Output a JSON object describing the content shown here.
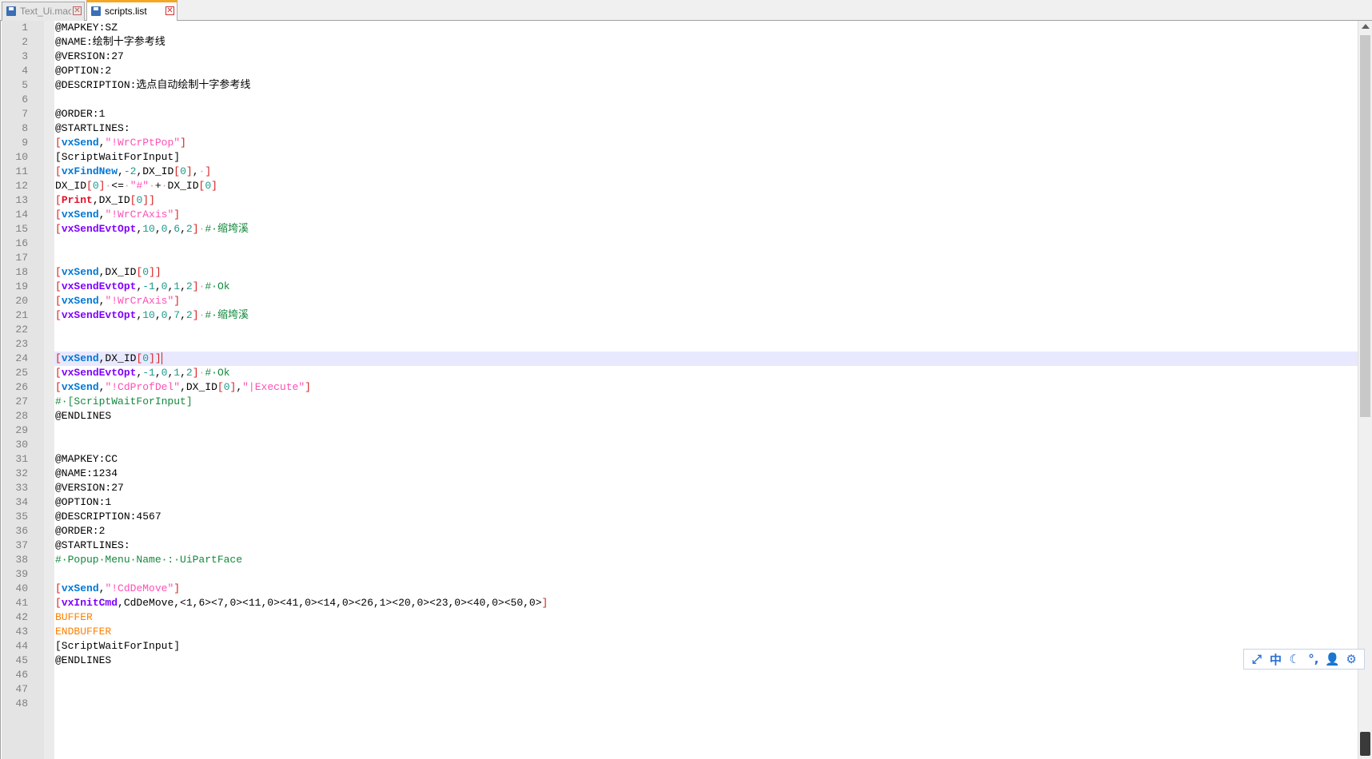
{
  "tabs": [
    {
      "label": "Text_Ui.mac",
      "active": false,
      "close_glyph": "✕"
    },
    {
      "label": "scripts.list",
      "active": true,
      "close_glyph": "✕"
    }
  ],
  "editor": {
    "current_line": 24,
    "lines": [
      {
        "n": "1",
        "t": [
          [
            "p",
            "@MAPKEY:SZ"
          ]
        ]
      },
      {
        "n": "2",
        "t": [
          [
            "p",
            "@NAME:绘制十字参考线"
          ]
        ]
      },
      {
        "n": "3",
        "t": [
          [
            "p",
            "@VERSION:27"
          ]
        ]
      },
      {
        "n": "4",
        "t": [
          [
            "p",
            "@OPTION:2"
          ]
        ]
      },
      {
        "n": "5",
        "t": [
          [
            "p",
            "@DESCRIPTION:选点自动绘制十字参考线"
          ]
        ]
      },
      {
        "n": "6",
        "t": []
      },
      {
        "n": "7",
        "t": [
          [
            "p",
            "@ORDER:1"
          ]
        ]
      },
      {
        "n": "8",
        "t": [
          [
            "p",
            "@STARTLINES:"
          ]
        ]
      },
      {
        "n": "9",
        "t": [
          [
            "br",
            "["
          ],
          [
            "kw",
            "vxSend"
          ],
          [
            "p",
            ","
          ],
          [
            "str",
            "\"!WrCrPtPop\""
          ],
          [
            "br",
            "]"
          ]
        ]
      },
      {
        "n": "10",
        "t": [
          [
            "p",
            "[ScriptWaitForInput]"
          ]
        ]
      },
      {
        "n": "11",
        "t": [
          [
            "br",
            "["
          ],
          [
            "kw",
            "vxFindNew"
          ],
          [
            "p",
            ","
          ],
          [
            "num",
            "-2"
          ],
          [
            "p",
            ",DX_ID"
          ],
          [
            "br",
            "["
          ],
          [
            "num",
            "0"
          ],
          [
            "br",
            "]"
          ],
          [
            "p",
            ","
          ],
          [
            "ws",
            "·"
          ],
          [
            "br",
            "]"
          ]
        ]
      },
      {
        "n": "12",
        "t": [
          [
            "p",
            "DX_ID"
          ],
          [
            "br",
            "["
          ],
          [
            "num",
            "0"
          ],
          [
            "br",
            "]"
          ],
          [
            "ws",
            "·"
          ],
          [
            "p",
            "<="
          ],
          [
            "ws",
            "·"
          ],
          [
            "str",
            "\"#\""
          ],
          [
            "ws",
            "·"
          ],
          [
            "p",
            "+"
          ],
          [
            "ws",
            "·"
          ],
          [
            "p",
            "DX_ID"
          ],
          [
            "br",
            "["
          ],
          [
            "num",
            "0"
          ],
          [
            "br",
            "]"
          ]
        ]
      },
      {
        "n": "13",
        "t": [
          [
            "br",
            "["
          ],
          [
            "red",
            "Print"
          ],
          [
            "p",
            ",DX_ID"
          ],
          [
            "br",
            "["
          ],
          [
            "num",
            "0"
          ],
          [
            "br",
            "]]"
          ]
        ]
      },
      {
        "n": "14",
        "t": [
          [
            "br",
            "["
          ],
          [
            "kw",
            "vxSend"
          ],
          [
            "p",
            ","
          ],
          [
            "str",
            "\"!WrCrAxis\""
          ],
          [
            "br",
            "]"
          ]
        ]
      },
      {
        "n": "15",
        "t": [
          [
            "br",
            "["
          ],
          [
            "fn",
            "vxSendEvtOpt"
          ],
          [
            "p",
            ","
          ],
          [
            "num",
            "10"
          ],
          [
            "p",
            ","
          ],
          [
            "num",
            "0"
          ],
          [
            "p",
            ","
          ],
          [
            "num",
            "6"
          ],
          [
            "p",
            ","
          ],
          [
            "num",
            "2"
          ],
          [
            "br",
            "]"
          ],
          [
            "ws",
            "·"
          ],
          [
            "cmt",
            "#·缩垮溪"
          ]
        ]
      },
      {
        "n": "16",
        "t": []
      },
      {
        "n": "17",
        "t": []
      },
      {
        "n": "18",
        "t": [
          [
            "br",
            "["
          ],
          [
            "kw",
            "vxSend"
          ],
          [
            "p",
            ",DX_ID"
          ],
          [
            "br",
            "["
          ],
          [
            "num",
            "0"
          ],
          [
            "br",
            "]]"
          ]
        ]
      },
      {
        "n": "19",
        "t": [
          [
            "br",
            "["
          ],
          [
            "fn",
            "vxSendEvtOpt"
          ],
          [
            "p",
            ","
          ],
          [
            "num",
            "-1"
          ],
          [
            "p",
            ","
          ],
          [
            "num",
            "0"
          ],
          [
            "p",
            ","
          ],
          [
            "num",
            "1"
          ],
          [
            "p",
            ","
          ],
          [
            "num",
            "2"
          ],
          [
            "br",
            "]"
          ],
          [
            "ws",
            "·"
          ],
          [
            "cmt",
            "#·Ok"
          ]
        ]
      },
      {
        "n": "20",
        "t": [
          [
            "br",
            "["
          ],
          [
            "kw",
            "vxSend"
          ],
          [
            "p",
            ","
          ],
          [
            "str",
            "\"!WrCrAxis\""
          ],
          [
            "br",
            "]"
          ]
        ]
      },
      {
        "n": "21",
        "t": [
          [
            "br",
            "["
          ],
          [
            "fn",
            "vxSendEvtOpt"
          ],
          [
            "p",
            ","
          ],
          [
            "num",
            "10"
          ],
          [
            "p",
            ","
          ],
          [
            "num",
            "0"
          ],
          [
            "p",
            ","
          ],
          [
            "num",
            "7"
          ],
          [
            "p",
            ","
          ],
          [
            "num",
            "2"
          ],
          [
            "br",
            "]"
          ],
          [
            "ws",
            "·"
          ],
          [
            "cmt",
            "#·缩垮溪"
          ]
        ]
      },
      {
        "n": "22",
        "t": []
      },
      {
        "n": "23",
        "t": []
      },
      {
        "n": "24",
        "t": [
          [
            "br",
            "["
          ],
          [
            "kw",
            "vxSend"
          ],
          [
            "p",
            ",DX_ID"
          ],
          [
            "br",
            "["
          ],
          [
            "num",
            "0"
          ],
          [
            "br",
            "]]"
          ],
          [
            "caret",
            ""
          ]
        ]
      },
      {
        "n": "25",
        "t": [
          [
            "br",
            "["
          ],
          [
            "fn",
            "vxSendEvtOpt"
          ],
          [
            "p",
            ","
          ],
          [
            "num",
            "-1"
          ],
          [
            "p",
            ","
          ],
          [
            "num",
            "0"
          ],
          [
            "p",
            ","
          ],
          [
            "num",
            "1"
          ],
          [
            "p",
            ","
          ],
          [
            "num",
            "2"
          ],
          [
            "br",
            "]"
          ],
          [
            "ws",
            "·"
          ],
          [
            "cmt",
            "#·Ok"
          ]
        ]
      },
      {
        "n": "26",
        "t": [
          [
            "br",
            "["
          ],
          [
            "kw",
            "vxSend"
          ],
          [
            "p",
            ","
          ],
          [
            "str",
            "\"!CdProfDel\""
          ],
          [
            "p",
            ",DX_ID"
          ],
          [
            "br",
            "["
          ],
          [
            "num",
            "0"
          ],
          [
            "br",
            "]"
          ],
          [
            "p",
            ","
          ],
          [
            "str",
            "\"|Execute\""
          ],
          [
            "br",
            "]"
          ]
        ]
      },
      {
        "n": "27",
        "t": [
          [
            "cmt",
            "#·[ScriptWaitForInput]"
          ]
        ]
      },
      {
        "n": "28",
        "t": [
          [
            "p",
            "@ENDLINES"
          ]
        ]
      },
      {
        "n": "29",
        "t": []
      },
      {
        "n": "30",
        "t": []
      },
      {
        "n": "31",
        "t": [
          [
            "p",
            "@MAPKEY:CC"
          ]
        ]
      },
      {
        "n": "32",
        "t": [
          [
            "p",
            "@NAME:1234"
          ]
        ]
      },
      {
        "n": "33",
        "t": [
          [
            "p",
            "@VERSION:27"
          ]
        ]
      },
      {
        "n": "34",
        "t": [
          [
            "p",
            "@OPTION:1"
          ]
        ]
      },
      {
        "n": "35",
        "t": [
          [
            "p",
            "@DESCRIPTION:4567"
          ]
        ]
      },
      {
        "n": "36",
        "t": [
          [
            "p",
            "@ORDER:2"
          ]
        ]
      },
      {
        "n": "37",
        "t": [
          [
            "p",
            "@STARTLINES:"
          ]
        ]
      },
      {
        "n": "38",
        "t": [
          [
            "cmt",
            "#·Popup·Menu·Name·:·UiPartFace"
          ]
        ]
      },
      {
        "n": "39",
        "t": []
      },
      {
        "n": "40",
        "t": [
          [
            "br",
            "["
          ],
          [
            "kw",
            "vxSend"
          ],
          [
            "p",
            ","
          ],
          [
            "str",
            "\"!CdDeMove\""
          ],
          [
            "br",
            "]"
          ]
        ]
      },
      {
        "n": "41",
        "t": [
          [
            "br",
            "["
          ],
          [
            "fn",
            "vxInitCmd"
          ],
          [
            "p",
            ",CdDeMove,<1,6><7,0><11,0><41,0><14,0><26,1><20,0><23,0><40,0><50,0>"
          ],
          [
            "br",
            "]"
          ]
        ]
      },
      {
        "n": "42",
        "t": [
          [
            "orange",
            "BUFFER"
          ]
        ]
      },
      {
        "n": "43",
        "t": [
          [
            "orange",
            "ENDBUFFER"
          ]
        ]
      },
      {
        "n": "44",
        "t": [
          [
            "p",
            "[ScriptWaitForInput]"
          ]
        ]
      },
      {
        "n": "45",
        "t": [
          [
            "p",
            "@ENDLINES"
          ]
        ]
      },
      {
        "n": "46",
        "t": []
      },
      {
        "n": "47",
        "t": []
      },
      {
        "n": "48",
        "t": []
      }
    ]
  },
  "ime_toolbar": {
    "buttons": [
      {
        "name": "ime-switch-icon",
        "glyph": "⤢"
      },
      {
        "name": "ime-chinese-mode",
        "glyph": "中"
      },
      {
        "name": "ime-halfwidth-moon-icon",
        "glyph": "☾"
      },
      {
        "name": "ime-punctuation-icon",
        "glyph": "°,"
      },
      {
        "name": "ime-user-icon",
        "glyph": "👤"
      },
      {
        "name": "ime-settings-gear-icon",
        "glyph": "⚙"
      }
    ]
  }
}
